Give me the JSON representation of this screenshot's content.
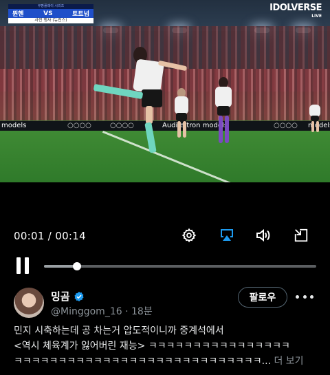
{
  "video": {
    "scoreboard": {
      "header": "쿠팡플레이 시리즈",
      "home_team": "뮌헨",
      "versus": "VS",
      "away_team": "토트넘",
      "subtitle": "사전 행사 (뉴진스)"
    },
    "channel_logo": "IDOLVERSE",
    "channel_live": "LIVE",
    "ad_text": [
      "models",
      "Audi e-tron models",
      "models"
    ]
  },
  "player": {
    "current_time": "00:01",
    "separator": " / ",
    "duration": "00:14",
    "progress": 0.12,
    "icons": [
      "settings-icon",
      "airplay-icon",
      "volume-icon",
      "exit-fullscreen-icon",
      "pause-icon"
    ]
  },
  "tweet": {
    "display_name": "밍곰",
    "handle": "@Minggom_16",
    "time": "18분",
    "follow_label": "팔로우",
    "text_line1": "민지 시축하는데 공 차는거 압도적이니까 중계석에서",
    "text_line2": "<역시 체육계가 잃어버린 재능> ㅋㅋㅋㅋㅋㅋㅋㅋㅋㅋㅋㅋㅋㅋㅋㅋ",
    "text_line3": "ㅋㅋㅋㅋㅋㅋㅋㅋㅋㅋㅋㅋㅋㅋㅋㅋㅋㅋㅋㅋㅋㅋㅋㅋㅋㅋㅋㅋ...",
    "see_more": "더 보기",
    "colors": {
      "verified": "#1d9bf0",
      "accent_airplay": "#1d9bf0"
    }
  }
}
